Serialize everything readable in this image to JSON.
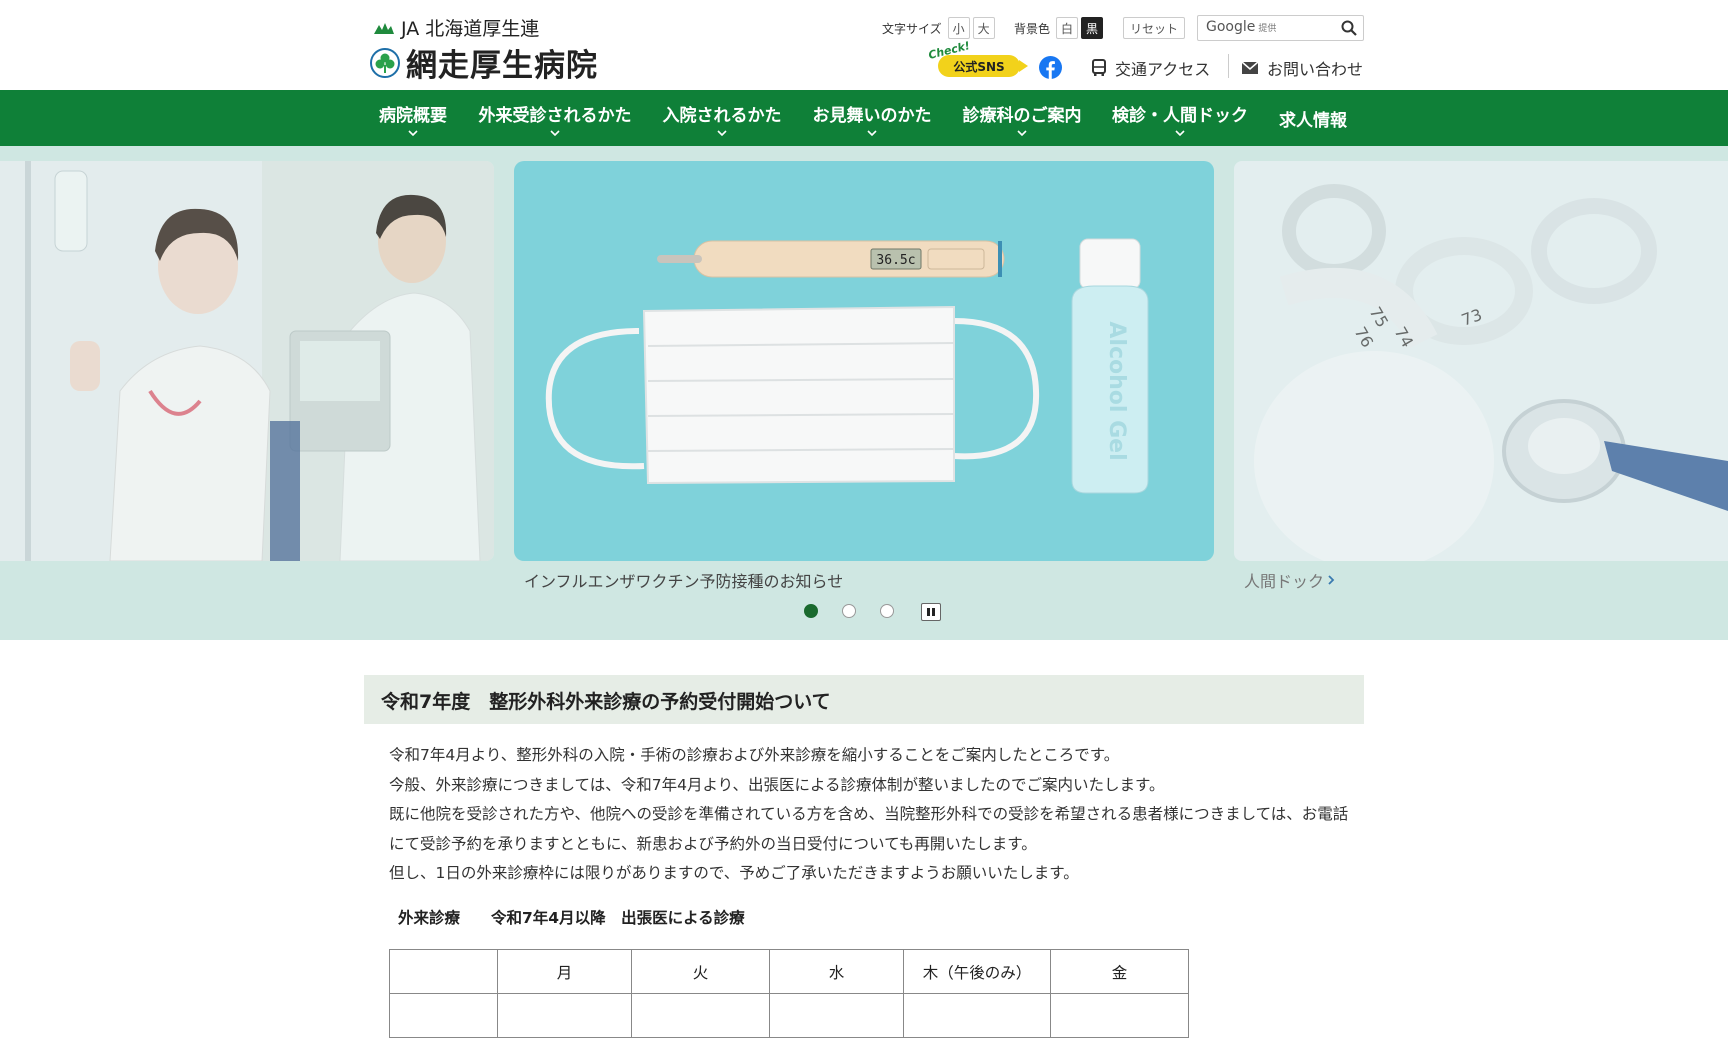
{
  "header": {
    "org_name": "JA 北海道厚生連",
    "hospital_name": "網走厚生病院",
    "font_size_label": "文字サイズ",
    "font_small": "小",
    "font_large": "大",
    "bg_color_label": "背景色",
    "bg_white": "白",
    "bg_black": "黒",
    "reset_label": "リセット",
    "search_brand": "Google",
    "search_provided": "提供",
    "sns_check": "Check!",
    "sns_label": "公式SNS",
    "access_label": "交通アクセス",
    "contact_label": "お問い合わせ"
  },
  "nav": {
    "items": [
      {
        "label": "病院概要",
        "has_submenu": true
      },
      {
        "label": "外来受診されるかた",
        "has_submenu": true
      },
      {
        "label": "入院されるかた",
        "has_submenu": true
      },
      {
        "label": "お見舞いのかた",
        "has_submenu": true
      },
      {
        "label": "診療科のご案内",
        "has_submenu": true
      },
      {
        "label": "検診・人間ドック",
        "has_submenu": true
      },
      {
        "label": "求人情報",
        "has_submenu": false
      }
    ]
  },
  "slider": {
    "center_caption": "インフルエンザワクチン予防接種のお知らせ",
    "right_caption": "人間ドック",
    "thermometer_reading": "36.5c",
    "bottle_label": "Alcohol Gel",
    "tape_numbers": [
      "73",
      "74",
      "75",
      "76"
    ],
    "active_dot": 1,
    "dot_count": 3
  },
  "article": {
    "title": "令和7年度　整形外科外来診療の予約受付開始ついて",
    "paragraphs": [
      "令和7年4月より、整形外科の入院・手術の診療および外来診療を縮小することをご案内したところです。",
      "今般、外来診療につきましては、令和7年4月より、出張医による診療体制が整いましたのでご案内いたします。",
      "既に他院を受診された方や、他院への受診を準備されている方を含め、当院整形外科での受診を希望される患者様につきましては、お電話にて受診予約を承りますとともに、新患および予約外の当日受付についても再開いたします。",
      "但し、1日の外来診療枠には限りがありますので、予めご了承いただきますようお願いいたします。"
    ],
    "schedule_heading": "外来診療　　令和7年4月以降　出張医による診療",
    "schedule_columns": [
      "",
      "月",
      "火",
      "水",
      "木（午後のみ）",
      "金"
    ]
  },
  "colors": {
    "brand_green": "#0f8038",
    "slider_bg": "#cfe7e2",
    "title_bg": "#e6ede6",
    "sns_yellow": "#f2d21b"
  }
}
